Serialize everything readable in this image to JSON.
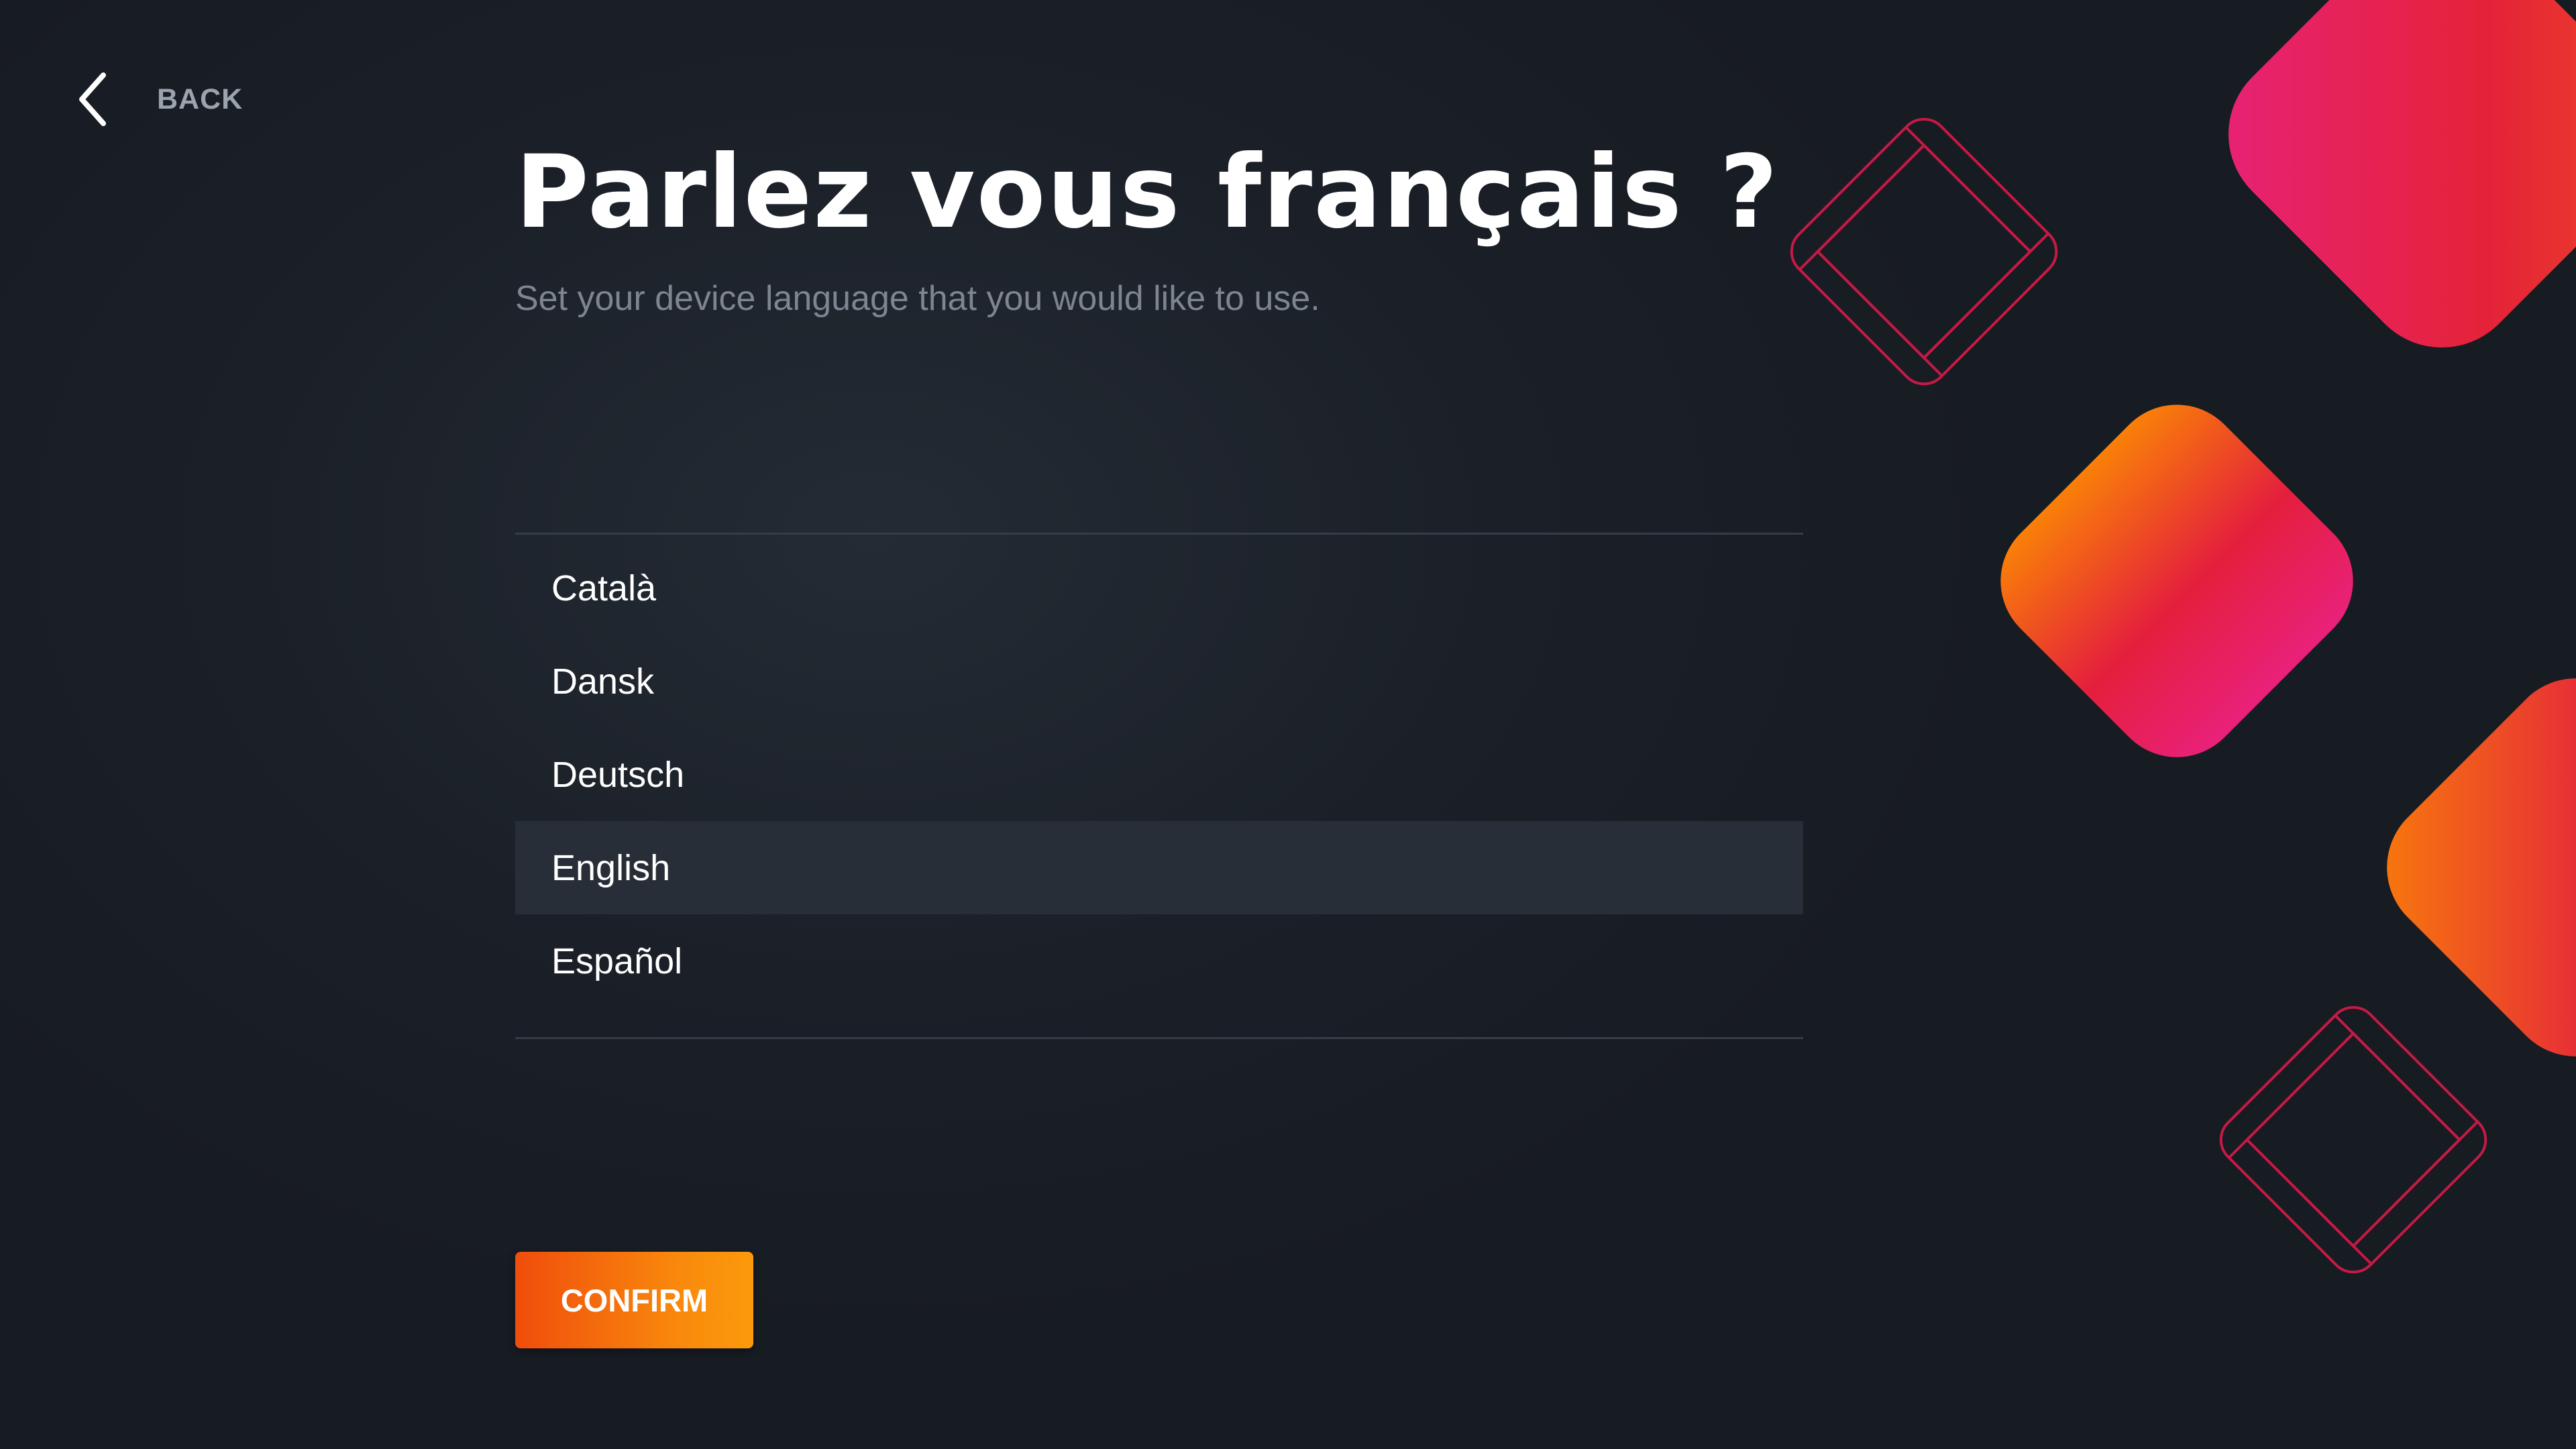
{
  "nav": {
    "back_label": "BACK",
    "back_icon": "chevron-left-icon"
  },
  "header": {
    "title": "Parlez vous français ?",
    "subtitle": "Set your device language that you would like to use."
  },
  "languages": {
    "items": [
      {
        "label": "Català",
        "selected": false
      },
      {
        "label": "Dansk",
        "selected": false
      },
      {
        "label": "Deutsch",
        "selected": false
      },
      {
        "label": "English",
        "selected": true
      },
      {
        "label": "Español",
        "selected": false
      }
    ]
  },
  "actions": {
    "confirm_label": "CONFIRM"
  },
  "colors": {
    "background": "#1b2028",
    "accent_orange": "#f98a0c",
    "accent_red": "#e41f3c",
    "accent_pink": "#e8227a",
    "selected_row": "#272e37"
  }
}
